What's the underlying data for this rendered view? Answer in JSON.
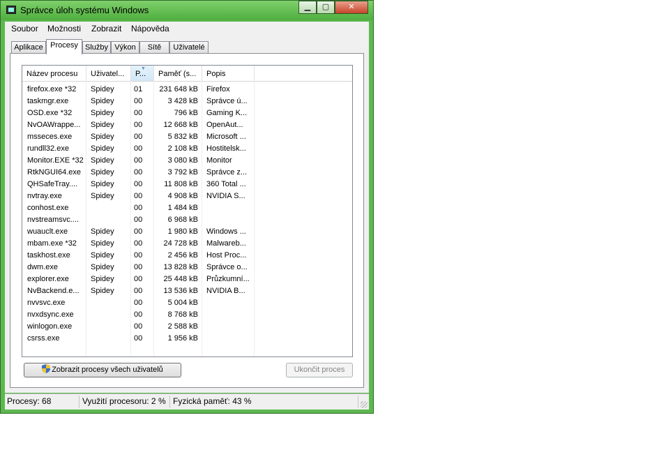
{
  "window": {
    "title": "Správce úloh systému Windows",
    "minimize": "▁",
    "maximize": "▢",
    "close": "✕"
  },
  "menu": [
    "Soubor",
    "Možnosti",
    "Zobrazit",
    "Nápověda"
  ],
  "tabs": [
    "Aplikace",
    "Procesy",
    "Služby",
    "Výkon",
    "Sítě",
    "Uživatelé"
  ],
  "active_tab": "Procesy",
  "table": {
    "columns": [
      "Název procesu",
      "Uživatel...",
      "P...",
      "Paměť (s...",
      "Popis"
    ],
    "sorted_column": "P...",
    "rows": [
      [
        "firefox.exe *32",
        "Spidey",
        "01",
        "231 648 kB",
        "Firefox"
      ],
      [
        "taskmgr.exe",
        "Spidey",
        "00",
        "3 428 kB",
        "Správce ú..."
      ],
      [
        "OSD.exe *32",
        "Spidey",
        "00",
        "796 kB",
        "Gaming K..."
      ],
      [
        "NvOAWrappe...",
        "Spidey",
        "00",
        "12 668 kB",
        "OpenAut..."
      ],
      [
        "msseces.exe",
        "Spidey",
        "00",
        "5 832 kB",
        "Microsoft ..."
      ],
      [
        "rundll32.exe",
        "Spidey",
        "00",
        "2 108 kB",
        "Hostitelsk..."
      ],
      [
        "Monitor.EXE *32",
        "Spidey",
        "00",
        "3 080 kB",
        "Monitor"
      ],
      [
        "RtkNGUI64.exe",
        "Spidey",
        "00",
        "3 792 kB",
        "Správce z..."
      ],
      [
        "QHSafeTray....",
        "Spidey",
        "00",
        "11 808 kB",
        "360 Total ..."
      ],
      [
        "nvtray.exe",
        "Spidey",
        "00",
        "4 908 kB",
        "NVIDIA S..."
      ],
      [
        "conhost.exe",
        "",
        "00",
        "1 484 kB",
        ""
      ],
      [
        "nvstreamsvc....",
        "",
        "00",
        "6 968 kB",
        ""
      ],
      [
        "wuauclt.exe",
        "Spidey",
        "00",
        "1 980 kB",
        "Windows ..."
      ],
      [
        "mbam.exe *32",
        "Spidey",
        "00",
        "24 728 kB",
        "Malwareb..."
      ],
      [
        "taskhost.exe",
        "Spidey",
        "00",
        "2 456 kB",
        "Host Proc..."
      ],
      [
        "dwm.exe",
        "Spidey",
        "00",
        "13 828 kB",
        "Správce o..."
      ],
      [
        "explorer.exe",
        "Spidey",
        "00",
        "25 448 kB",
        "Průzkumní..."
      ],
      [
        "NvBackend.e...",
        "Spidey",
        "00",
        "13 536 kB",
        "NVIDIA B..."
      ],
      [
        "nvvsvc.exe",
        "",
        "00",
        "5 004 kB",
        ""
      ],
      [
        "nvxdsync.exe",
        "",
        "00",
        "8 768 kB",
        ""
      ],
      [
        "winlogon.exe",
        "",
        "00",
        "2 588 kB",
        ""
      ],
      [
        "csrss.exe",
        "",
        "00",
        "1 956 kB",
        ""
      ]
    ]
  },
  "buttons": {
    "show_all": "Zobrazit procesy všech uživatelů",
    "end_process": "Ukončit proces"
  },
  "status": {
    "processes": "Procesy: 68",
    "cpu": "Využití procesoru: 2 %",
    "memory": "Fyzická paměť: 43 %"
  },
  "colors": {
    "frame": "#5db84f",
    "header_sorted": "#d2e8f7"
  }
}
